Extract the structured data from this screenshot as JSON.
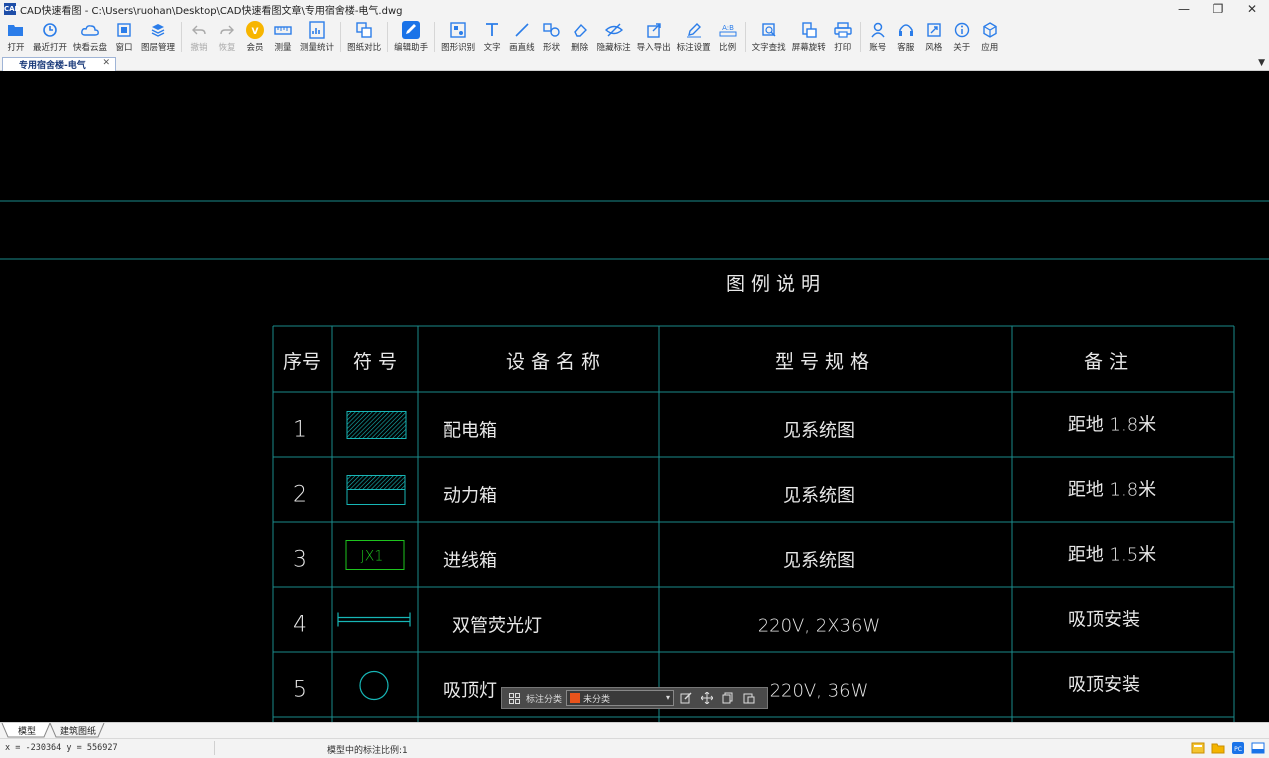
{
  "window": {
    "title": "CAD快速看图 - C:\\Users\\ruohan\\Desktop\\CAD快速看图文章\\专用宿舍楼-电气.dwg",
    "app_icon_text": "CAD",
    "minimize": "—",
    "restore": "❐",
    "close": "✕"
  },
  "toolbar": {
    "groups": [
      [
        {
          "label": "打开",
          "icon": "folder-open-icon",
          "disabled": false
        },
        {
          "label": "最近打开",
          "icon": "clock-icon",
          "disabled": false
        },
        {
          "label": "快看云盘",
          "icon": "cloud-icon",
          "disabled": false
        },
        {
          "label": "窗口",
          "icon": "window-icon",
          "disabled": false
        },
        {
          "label": "图层管理",
          "icon": "layers-icon",
          "disabled": false
        }
      ],
      [
        {
          "label": "撤销",
          "icon": "undo-icon",
          "disabled": true
        },
        {
          "label": "恢复",
          "icon": "redo-icon",
          "disabled": true
        },
        {
          "label": "会员",
          "icon": "vip-icon",
          "disabled": false
        },
        {
          "label": "测量",
          "icon": "ruler-icon",
          "disabled": false
        },
        {
          "label": "测量统计",
          "icon": "measure-stats-icon",
          "disabled": false
        }
      ],
      [
        {
          "label": "图纸对比",
          "icon": "compare-icon",
          "disabled": false
        }
      ],
      [
        {
          "label": "编辑助手",
          "icon": "edit-assistant-icon",
          "disabled": false
        }
      ],
      [
        {
          "label": "图形识别",
          "icon": "shape-recognize-icon",
          "disabled": false
        },
        {
          "label": "文字",
          "icon": "text-icon",
          "disabled": false
        },
        {
          "label": "画直线",
          "icon": "line-icon",
          "disabled": false
        },
        {
          "label": "形状",
          "icon": "shapes-icon",
          "disabled": false
        },
        {
          "label": "删除",
          "icon": "eraser-icon",
          "disabled": false
        },
        {
          "label": "隐藏标注",
          "icon": "eye-off-icon",
          "disabled": false
        },
        {
          "label": "导入导出",
          "icon": "import-export-icon",
          "disabled": false
        },
        {
          "label": "标注设置",
          "icon": "annotation-settings-icon",
          "disabled": false
        },
        {
          "label": "比例",
          "icon": "scale-icon",
          "disabled": false
        }
      ],
      [
        {
          "label": "文字查找",
          "icon": "text-search-icon",
          "disabled": false
        },
        {
          "label": "屏幕旋转",
          "icon": "rotate-screen-icon",
          "disabled": false
        },
        {
          "label": "打印",
          "icon": "printer-icon",
          "disabled": false
        }
      ],
      [
        {
          "label": "账号",
          "icon": "user-icon",
          "disabled": false
        },
        {
          "label": "客服",
          "icon": "headset-icon",
          "disabled": false
        },
        {
          "label": "风格",
          "icon": "style-icon",
          "disabled": false
        },
        {
          "label": "关于",
          "icon": "info-icon",
          "disabled": false
        },
        {
          "label": "应用",
          "icon": "apps-icon",
          "disabled": false
        }
      ]
    ]
  },
  "tabs": {
    "active_doc": "专用宿舍楼-电气",
    "close_glyph": "✕",
    "menu_glyph": "▼"
  },
  "drawing": {
    "legend_title": "图 例 说 明",
    "headers": [
      "序号",
      "符 号",
      "设 备 名 称",
      "型 号 规 格",
      "备  注"
    ],
    "rows": [
      {
        "no": "1",
        "symbol": "hatched-box",
        "symbol_text": "",
        "name": "配电箱",
        "spec": "见系统图",
        "note": "距地 1.8米"
      },
      {
        "no": "2",
        "symbol": "half-hatched-box",
        "symbol_text": "",
        "name": "动力箱",
        "spec": "见系统图",
        "note": "距地 1.8米"
      },
      {
        "no": "3",
        "symbol": "labeled-box",
        "symbol_text": "JX1",
        "name": "进线箱",
        "spec": "见系统图",
        "note": "距地 1.5米"
      },
      {
        "no": "4",
        "symbol": "fluorescent-lamp",
        "symbol_text": "",
        "name": "双管荧光灯",
        "spec": "220V, 2X36W",
        "note": "吸顶安装"
      },
      {
        "no": "5",
        "symbol": "circle-lamp",
        "symbol_text": "",
        "name": "吸顶灯",
        "spec": "220V, 36W",
        "note": "吸顶安装"
      }
    ],
    "colors": {
      "line": "#1a8a8a",
      "text": "#e8e8e8",
      "symbol": "#17b6b6",
      "green": "#1ec41e"
    }
  },
  "floatbar": {
    "category_label": "标注分类",
    "selected": "未分类",
    "swatch_color": "#e8531b"
  },
  "sheets": [
    "模型",
    "建筑图纸"
  ],
  "status": {
    "coords": "x = -230364  y = 556927",
    "scale": "模型中的标注比例:1"
  }
}
